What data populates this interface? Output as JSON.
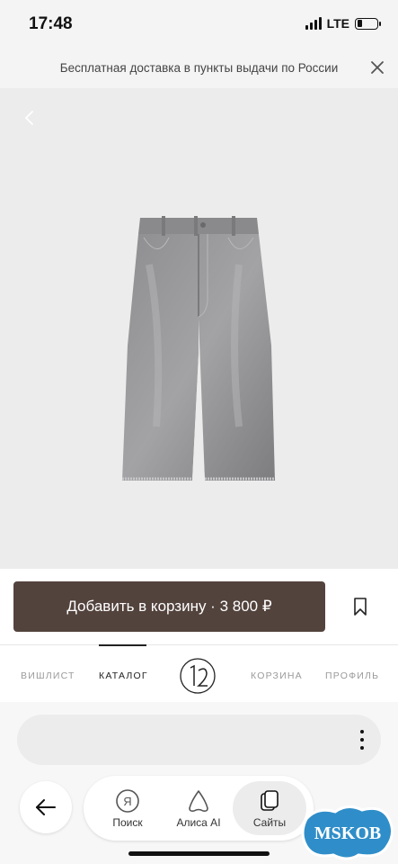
{
  "status_bar": {
    "time": "17:48",
    "network": "LTE",
    "battery_level": 0.25
  },
  "promo": {
    "text": "Бесплатная доставка в пункты выдачи по России",
    "close_icon": "close-icon"
  },
  "product": {
    "image_description_icon": "denim-shorts-image",
    "back_icon": "chevron-left-icon",
    "background_color": "#ececec"
  },
  "cart": {
    "button_label": "Добавить в корзину · 3 800 ₽",
    "button_color": "#53433d",
    "wishlist_icon": "bookmark-icon"
  },
  "bottom_nav": {
    "items": [
      {
        "label": "ВИШЛИСТ",
        "active": false
      },
      {
        "label": "КАТАЛОГ",
        "active": true
      },
      {
        "label": "КОРЗИНА",
        "active": false
      },
      {
        "label": "ПРОФИЛЬ",
        "active": false
      }
    ],
    "logo_icon": "brand-logo-icon"
  },
  "browser": {
    "url_field_value": "",
    "menu_icon": "more-vertical-icon",
    "back_icon": "arrow-left-icon",
    "tabs": [
      {
        "label": "Поиск",
        "icon": "yandex-search-icon",
        "active": false
      },
      {
        "label": "Алиса AI",
        "icon": "alice-icon",
        "active": false
      },
      {
        "label": "Сайты",
        "icon": "tabs-icon",
        "active": true
      }
    ]
  },
  "watermark": {
    "text": "MSKOB"
  }
}
